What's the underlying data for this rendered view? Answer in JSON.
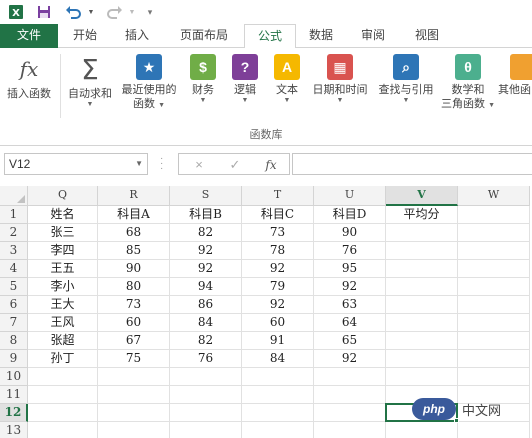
{
  "quick_access": {
    "excel_icon": "excel-logo-icon",
    "save_icon": "save-icon",
    "undo_icon": "undo-icon",
    "redo_icon": "redo-icon"
  },
  "tabs": [
    {
      "label": "文件"
    },
    {
      "label": "开始"
    },
    {
      "label": "插入"
    },
    {
      "label": "页面布局"
    },
    {
      "label": "公式"
    },
    {
      "label": "数据"
    },
    {
      "label": "审阅"
    },
    {
      "label": "视图"
    }
  ],
  "active_tab": "公式",
  "ribbon": {
    "buttons": [
      {
        "label": "插入函数",
        "label2": "",
        "icon": "fx-icon",
        "color": "#ffffff",
        "glyph": "fx"
      },
      {
        "label": "自动求和",
        "label2": "",
        "icon": "sigma-icon",
        "color": "#ffffff",
        "glyph": "Σ"
      },
      {
        "label": "最近使用的",
        "label2": "函数",
        "icon": "star-book-icon",
        "color": "#2e75b6",
        "glyph": "★"
      },
      {
        "label": "财务",
        "label2": "",
        "icon": "coins-book-icon",
        "color": "#70ad47",
        "glyph": "$"
      },
      {
        "label": "逻辑",
        "label2": "",
        "icon": "question-book-icon",
        "color": "#7e3f98",
        "glyph": "?"
      },
      {
        "label": "文本",
        "label2": "",
        "icon": "text-book-icon",
        "color": "#f5b800",
        "glyph": "A"
      },
      {
        "label": "日期和时间",
        "label2": "",
        "icon": "calendar-book-icon",
        "color": "#d9534f",
        "glyph": "▦"
      },
      {
        "label": "查找与引用",
        "label2": "",
        "icon": "magnifier-book-icon",
        "color": "#2e75b6",
        "glyph": "⌕"
      },
      {
        "label": "数学和",
        "label2": "三角函数",
        "icon": "theta-book-icon",
        "color": "#4caf8e",
        "glyph": "θ"
      },
      {
        "label": "其他函",
        "label2": "",
        "icon": "more-functions-icon",
        "color": "#f0a030",
        "glyph": ""
      }
    ],
    "group_label": "函数库"
  },
  "formula_bar": {
    "name_box": "V12",
    "cancel_icon": "×",
    "enter_icon": "✓",
    "fx_label": "fx",
    "formula": ""
  },
  "grid": {
    "columns": [
      "Q",
      "R",
      "S",
      "T",
      "U",
      "V",
      "W"
    ],
    "selected_column": "V",
    "row_numbers": [
      "1",
      "2",
      "3",
      "4",
      "5",
      "6",
      "7",
      "8",
      "9",
      "10",
      "11",
      "12",
      "13"
    ],
    "selected_row": "12",
    "rows": [
      [
        "姓名",
        "科目A",
        "科目B",
        "科目C",
        "科目D",
        "平均分",
        ""
      ],
      [
        "张三",
        "68",
        "82",
        "73",
        "90",
        "",
        ""
      ],
      [
        "李四",
        "85",
        "92",
        "78",
        "76",
        "",
        ""
      ],
      [
        "王五",
        "90",
        "92",
        "92",
        "95",
        "",
        ""
      ],
      [
        "李小",
        "80",
        "94",
        "79",
        "92",
        "",
        ""
      ],
      [
        "王大",
        "73",
        "86",
        "92",
        "63",
        "",
        ""
      ],
      [
        "王风",
        "60",
        "84",
        "60",
        "64",
        "",
        ""
      ],
      [
        "张超",
        "67",
        "82",
        "91",
        "65",
        "",
        ""
      ],
      [
        "孙丁",
        "75",
        "76",
        "84",
        "92",
        "",
        ""
      ],
      [
        "",
        "",
        "",
        "",
        "",
        "",
        ""
      ],
      [
        "",
        "",
        "",
        "",
        "",
        "",
        ""
      ],
      [
        "",
        "",
        "",
        "",
        "",
        "",
        ""
      ],
      [
        "",
        "",
        "",
        "",
        "",
        "",
        ""
      ]
    ]
  },
  "watermark": {
    "logo": "php",
    "text": "中文网"
  },
  "colors": {
    "accent": "#217346"
  }
}
